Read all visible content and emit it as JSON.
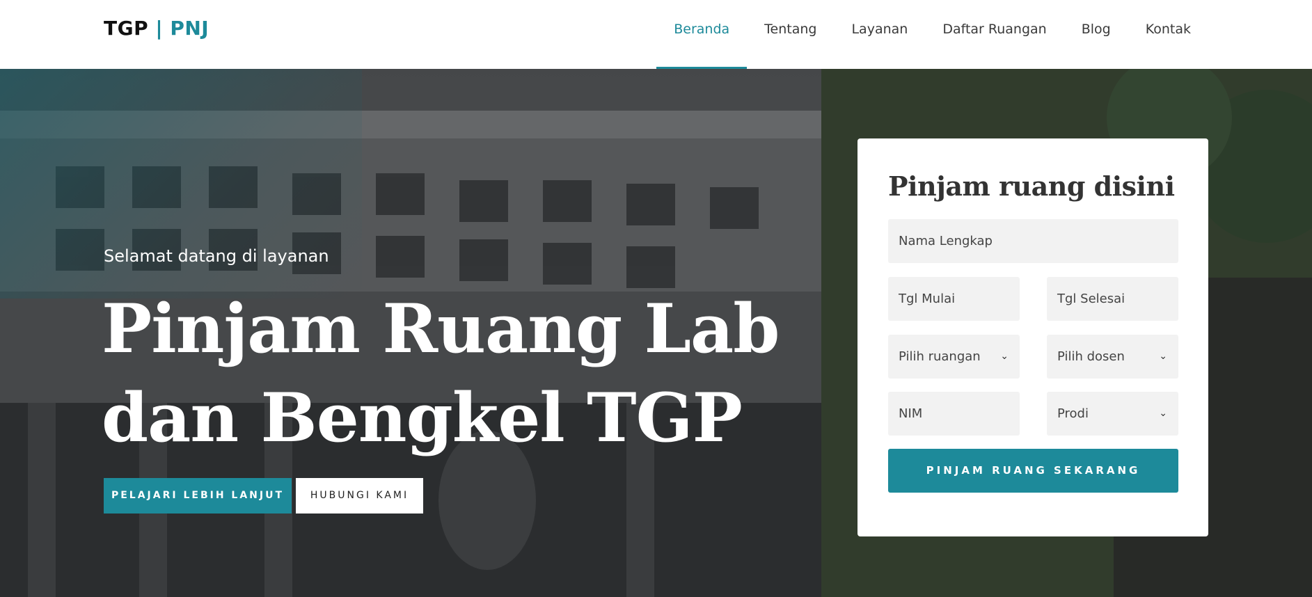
{
  "brand": {
    "part1": "TGP",
    "separator": "|",
    "part2": "PNJ"
  },
  "nav": {
    "items": [
      {
        "label": "Beranda",
        "active": true
      },
      {
        "label": "Tentang"
      },
      {
        "label": "Layanan"
      },
      {
        "label": "Daftar Ruangan"
      },
      {
        "label": "Blog"
      },
      {
        "label": "Kontak"
      }
    ]
  },
  "hero": {
    "subtitle": "Selamat datang di layanan",
    "title_line1": "Pinjam Ruang Lab",
    "title_line2": "dan Bengkel TGP",
    "primary_button": "PELAJARI LEBIH LANJUT",
    "secondary_button": "HUBUNGI KAMI"
  },
  "form": {
    "title": "Pinjam ruang disini",
    "nama_placeholder": "Nama Lengkap",
    "tgl_mulai_placeholder": "Tgl Mulai",
    "tgl_selesai_placeholder": "Tgl Selesai",
    "ruangan_select": "Pilih ruangan",
    "dosen_select": "Pilih dosen",
    "nim_placeholder": "NIM",
    "prodi_select": "Prodi",
    "submit_label": "PINJAM RUANG SEKARANG"
  },
  "colors": {
    "accent": "#1d8a9a"
  },
  "icons": {
    "select_chevron": "chevron-down-icon"
  }
}
